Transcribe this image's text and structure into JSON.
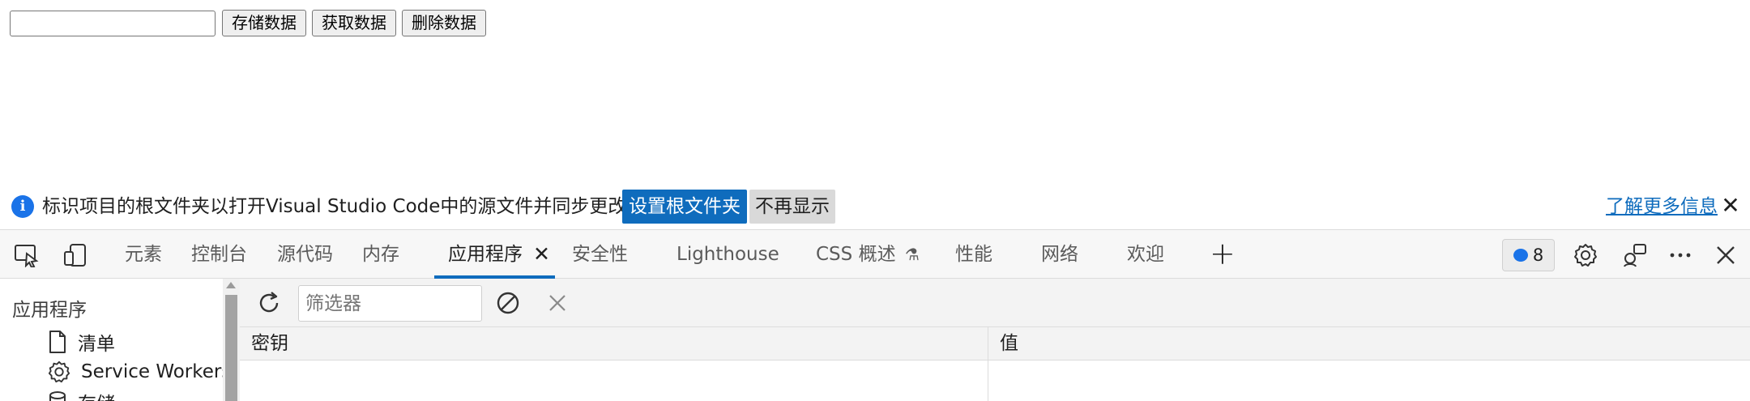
{
  "page": {
    "input_value": "",
    "buttons": [
      "存储数据",
      "获取数据",
      "删除数据"
    ]
  },
  "infobar": {
    "message": "标识项目的根文件夹以打开Visual Studio Code中的源文件并同步更改。",
    "primary_button": "设置根文件夹",
    "secondary_button": "不再显示",
    "learn_more": "了解更多信息"
  },
  "tabstrip": {
    "tabs": [
      "元素",
      "控制台",
      "源代码",
      "内存",
      "应用程序",
      "安全性",
      "Lighthouse",
      "CSS 概述",
      "性能",
      "网络",
      "欢迎"
    ],
    "active_tab": "应用程序",
    "issues_count": "8"
  },
  "sidebar": {
    "title": "应用程序",
    "items": [
      "清单",
      "Service Workers",
      "存储"
    ]
  },
  "main": {
    "filter_placeholder": "筛选器",
    "columns": [
      "密钥",
      "值"
    ]
  },
  "colors": {
    "accent": "#0f6cbd",
    "info_icon": "#1a73e8"
  }
}
